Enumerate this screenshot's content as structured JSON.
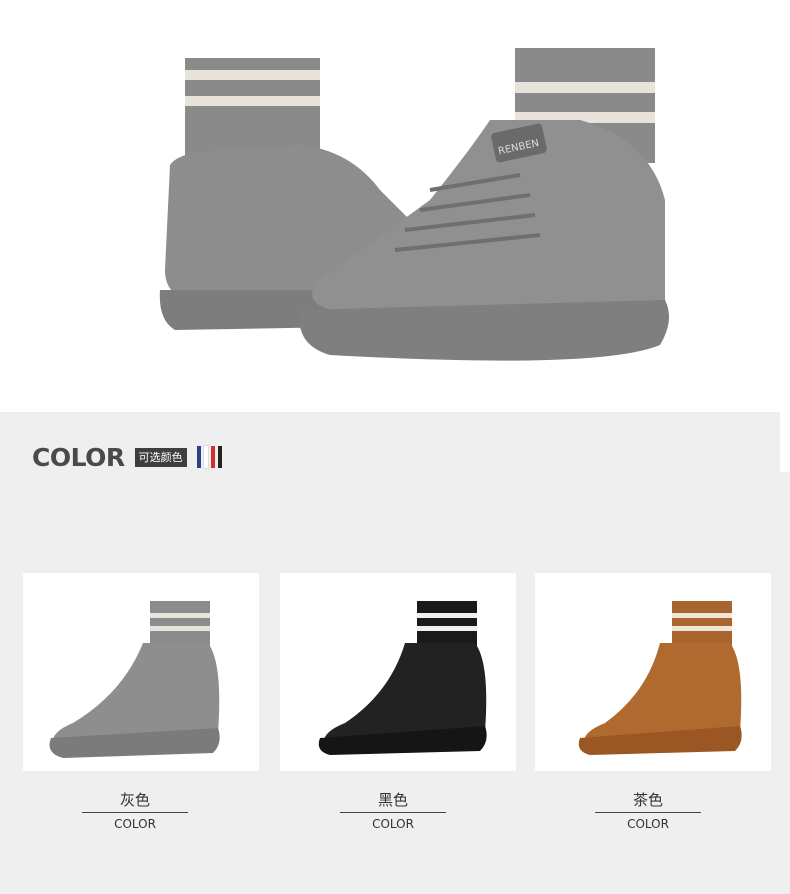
{
  "hero": {
    "shoe_brand_text": "RENBEN",
    "image": "gray-sock-high-top-sneakers-pair"
  },
  "color_section": {
    "title": "COLOR",
    "tag": "可选颜色",
    "flag_colors": [
      "#2b3f8c",
      "#ffffff",
      "#d32f2f",
      "#222222"
    ]
  },
  "variants": [
    {
      "name_zh": "灰色",
      "name_en": "COLOR",
      "swatch": "#8a8a8a"
    },
    {
      "name_zh": "黑色",
      "name_en": "COLOR",
      "swatch": "#222222"
    },
    {
      "name_zh": "茶色",
      "name_en": "COLOR",
      "swatch": "#a8662e"
    }
  ]
}
